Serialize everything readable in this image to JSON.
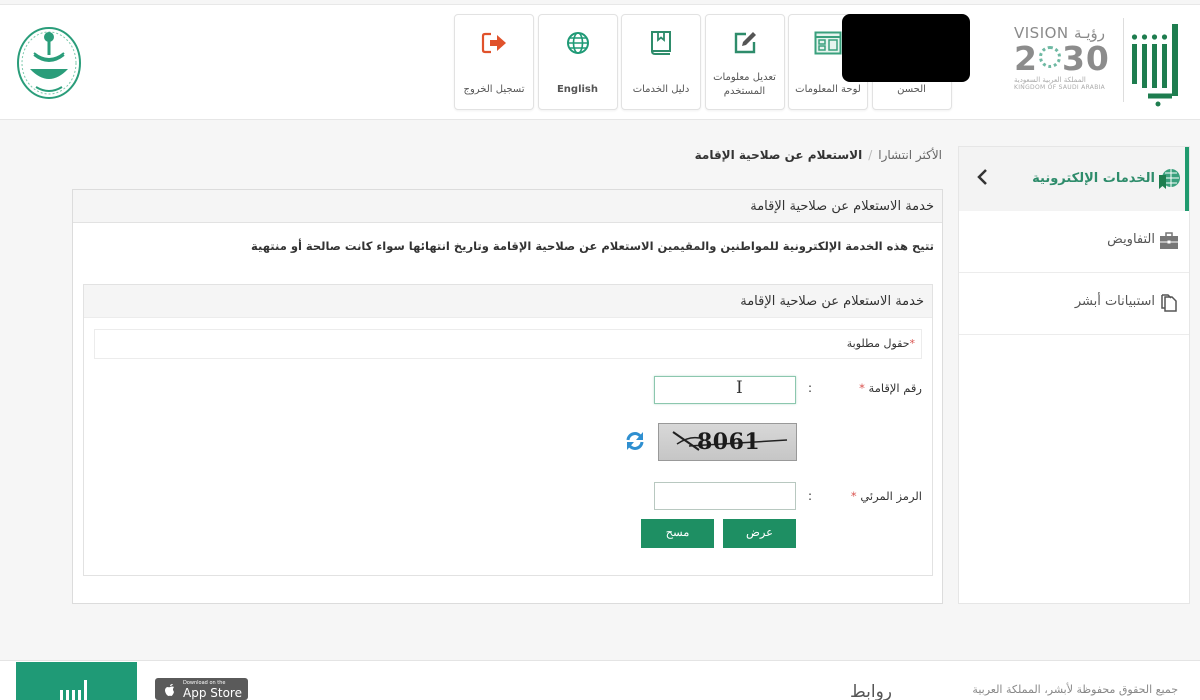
{
  "header": {
    "nav_tiles": [
      {
        "key": "logout",
        "label": "تسجيل الخروج",
        "icon": "logout-icon"
      },
      {
        "key": "language",
        "label": "English",
        "icon": "globe-icon"
      },
      {
        "key": "services_guide",
        "label": "دليل الخدمات",
        "icon": "book-icon"
      },
      {
        "key": "edit_user_info",
        "label_line1": "تعديل معلومات",
        "label_line2": "المستخدم",
        "icon": "edit-icon"
      },
      {
        "key": "dashboard",
        "label": "لوحة المعلومات",
        "icon": "dashboard-icon"
      },
      {
        "key": "account",
        "label": "الحسن",
        "icon": "user-icon"
      }
    ],
    "vision": {
      "top": "VISION رؤيـة",
      "number_left": "2",
      "number_right": "30",
      "sub_ar": "المملكة العربية السعودية",
      "sub_en": "KINGDOM OF SAUDI ARABIA"
    }
  },
  "breadcrumb": {
    "items": [
      "الأكثر انتشارا",
      "الاستعلام عن صلاحية الإقامة"
    ],
    "separator": "/"
  },
  "panel": {
    "title": "خدمة الاستعلام عن صلاحية الإقامة",
    "description": "تتيح هذه الخدمة الإلكترونية للمواطنين والمقيمين الاستعلام عن صلاحية الإقامة وتاريخ انتهائها سواء كانت صالحة أو منتهية",
    "form": {
      "title": "خدمة الاستعلام عن صلاحية الإقامة",
      "required_note": "حقول مطلوبة",
      "required_mark": "*",
      "iqama_label": "رقم الإقامة",
      "iqama_value": "",
      "colon": ":",
      "captcha_text": "8061",
      "captcha_label": "الرمز المرئي",
      "captcha_value": "",
      "submit_label": "عرض",
      "clear_label": "مسح"
    }
  },
  "sidebar": {
    "items": [
      {
        "label": "الخدمات الإلكترونية",
        "icon": "eservices-icon",
        "active": true
      },
      {
        "label": "التفاويض",
        "icon": "briefcase-icon",
        "active": false
      },
      {
        "label": "استبيانات أبشر",
        "icon": "documents-icon",
        "active": false
      }
    ]
  },
  "footer": {
    "appstore_small": "Download on the",
    "appstore_big": "App Store",
    "links_title": "روابط",
    "copyright": "جميع الحقوق محفوظة لأبشر، المملكة العربية"
  },
  "colors": {
    "brand_green": "#1e8f63",
    "accent_teal": "#2e8c6b",
    "logout_orange": "#e0522b",
    "refresh_blue": "#2f8fd0"
  }
}
